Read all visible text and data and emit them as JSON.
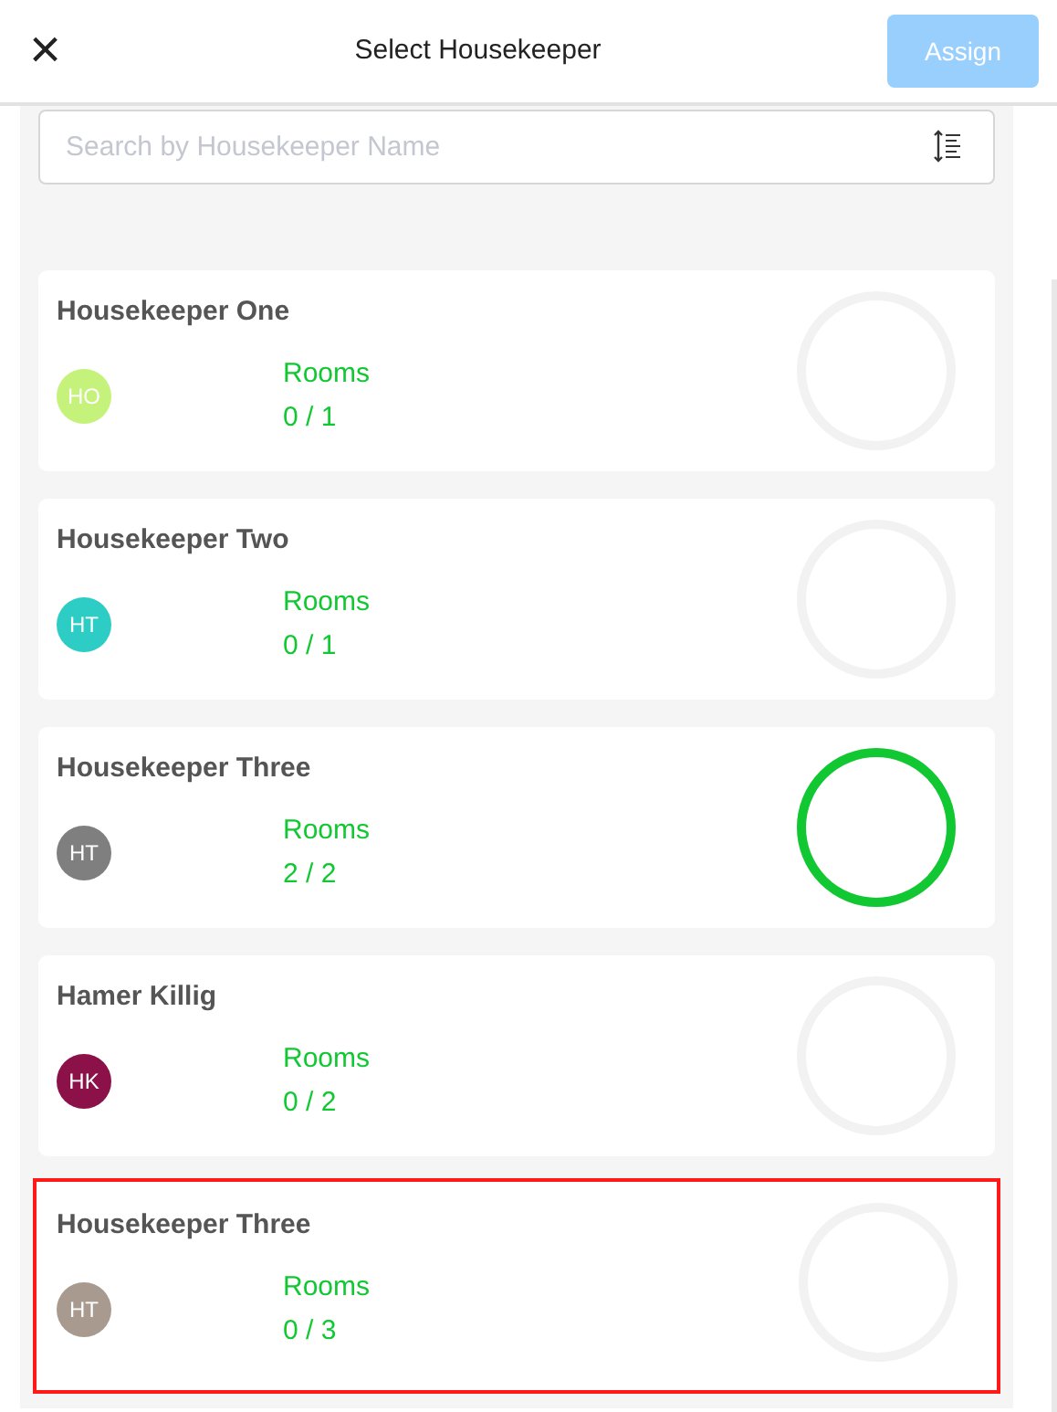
{
  "header": {
    "title": "Select Housekeeper",
    "close_icon": "×",
    "assign_button": {
      "label": "Assign",
      "disabled": true
    }
  },
  "search": {
    "placeholder": "Search by Housekeeper Name"
  },
  "housekeepers": [
    {
      "name": "Housekeeper One",
      "initials": "HO",
      "color": "#c5f27a",
      "rooms_label": "Rooms",
      "rooms": "0 / 1",
      "level": 0,
      "selected": false
    },
    {
      "name": "Housekeeper Two",
      "initials": "HT",
      "color": "#2dcdc6",
      "rooms_label": "Rooms",
      "rooms": "0 / 1",
      "level": 0,
      "selected": false
    },
    {
      "name": "Housekeeper Three",
      "initials": "HT",
      "color": "#7f7f7f",
      "rooms_label": "Rooms",
      "rooms": "2 / 2",
      "level": 1,
      "selected": false
    },
    {
      "name": "Hamer Killig",
      "initials": "HK",
      "color": "#8c1149",
      "rooms_label": "Rooms",
      "rooms": "0 / 2",
      "level": 0,
      "selected": false
    },
    {
      "name": "Housekeeper Three",
      "initials": "HT",
      "color": "#a89a8e",
      "rooms_label": "Rooms",
      "rooms": "0 / 3",
      "level": 0,
      "selected": true
    }
  ]
}
